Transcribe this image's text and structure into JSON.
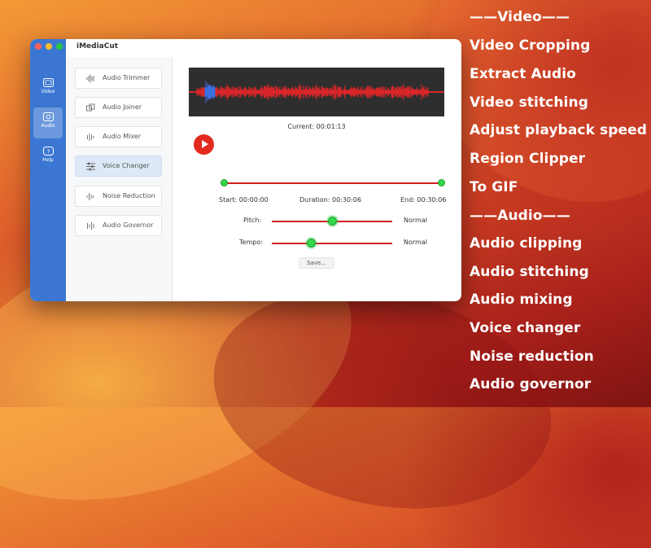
{
  "window": {
    "app_title": "iMediaCut"
  },
  "sidebar": {
    "items": [
      {
        "label": "Video",
        "icon": "video-icon",
        "active": false
      },
      {
        "label": "Audio",
        "icon": "audio-icon",
        "active": true
      },
      {
        "label": "Help",
        "icon": "help-icon",
        "active": false
      }
    ]
  },
  "tools": [
    {
      "label": "Audio Trimmer",
      "icon": "audio-trimmer-icon"
    },
    {
      "label": "Audio Joiner",
      "icon": "audio-joiner-icon"
    },
    {
      "label": "Audio Mixer",
      "icon": "audio-mixer-icon"
    },
    {
      "label": "Voice Changer",
      "icon": "sliders-icon",
      "active": true
    },
    {
      "label": "Noise Reduction",
      "icon": "noise-reduction-icon"
    },
    {
      "label": "Audio Governor",
      "icon": "audio-governor-icon"
    }
  ],
  "player": {
    "current": "Current: 00:01:13",
    "start": "Start: 00:00:00",
    "duration": "Duration: 00:30:06",
    "end": "End: 00:30:06"
  },
  "controls": {
    "pitch_label": "Pitch:",
    "pitch_value": "Normal",
    "pitch_level": 0.5,
    "tempo_label": "Tempo:",
    "tempo_value": "Normal",
    "tempo_level": 0.33,
    "save_label": "Save..."
  },
  "features": [
    "——Video——",
    "Video Cropping",
    "Extract Audio",
    "Video stitching",
    "Adjust playback speed",
    "Region Clipper",
    "To GIF",
    "——Audio——",
    "Audio clipping",
    "Audio stitching",
    "Audio mixing",
    "Voice changer",
    "Noise reduction",
    "Audio governor"
  ],
  "colors": {
    "accent_blue": "#3b77d2",
    "play_red": "#e22a1e",
    "slider_red": "#d42020",
    "knob_green": "#34d74a",
    "waveform_red": "#e8262a",
    "waveform_blue": "#3a6fe0"
  }
}
